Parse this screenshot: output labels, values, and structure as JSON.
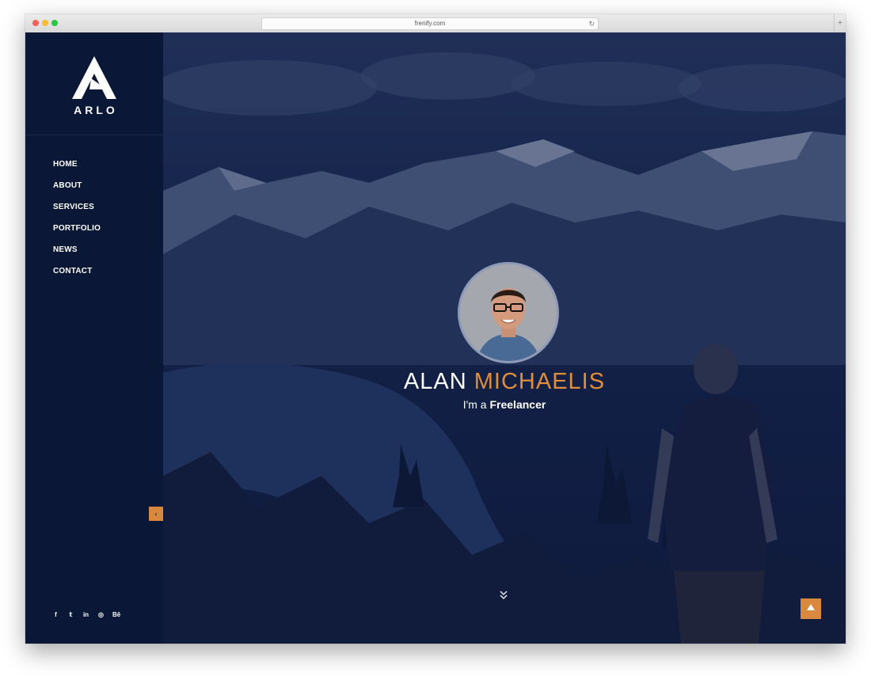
{
  "browser": {
    "url": "frenify.com",
    "reload_icon": "reload-icon",
    "new_tab": "+"
  },
  "brand": {
    "logo_text": "ARLO"
  },
  "nav": {
    "items": [
      "HOME",
      "ABOUT",
      "SERVICES",
      "PORTFOLIO",
      "NEWS",
      "CONTACT"
    ]
  },
  "sidebar": {
    "collapse_icon": "‹"
  },
  "socials": [
    {
      "label": "f",
      "icon": "facebook-icon"
    },
    {
      "label": "𝕥",
      "icon": "twitter-icon"
    },
    {
      "label": "in",
      "icon": "linkedin-icon"
    },
    {
      "label": "◎",
      "icon": "instagram-icon"
    },
    {
      "label": "Bē",
      "icon": "behance-icon"
    }
  ],
  "hero": {
    "first_name": "ALAN",
    "last_name": "MICHAELIS",
    "subtitle_prefix": "I'm a",
    "subtitle_role": "Freelancer",
    "scroll_icon": "»",
    "to_top_icon": "▲"
  },
  "colors": {
    "accent": "#d8893d",
    "sidebar": "#0a1736",
    "overlay": "#0c183c"
  }
}
